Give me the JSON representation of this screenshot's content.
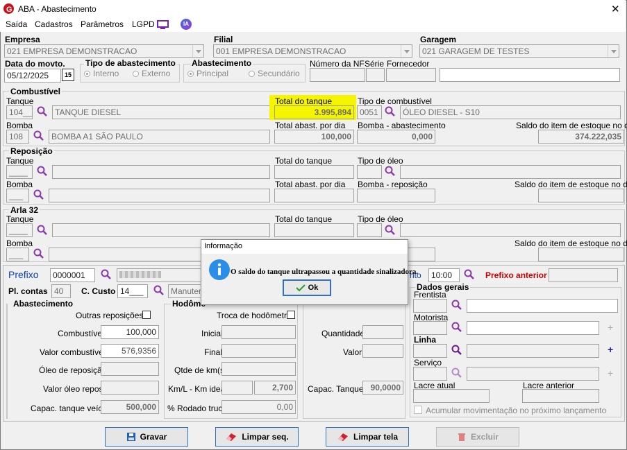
{
  "window": {
    "title": "ABA - Abastecimento",
    "close": "✕"
  },
  "menu": {
    "items": [
      "Saída",
      "Cadastros",
      "Parâmetros",
      "LGPD"
    ],
    "ia": "IA"
  },
  "header": {
    "empresa_label": "Empresa",
    "empresa": "021 EMPRESA DEMONSTRACAO",
    "filial_label": "Filial",
    "filial": "001 EMPRESA DEMONSTRACAO",
    "garagem_label": "Garagem",
    "garagem": "021 GARAGEM DE TESTES",
    "data_label": "Data do movto.",
    "data": "05/12/2025",
    "cal": "15",
    "tipo_label": "Tipo de abastecimento",
    "tipo_interno": "Interno",
    "tipo_externo": "Externo",
    "abast_label": "Abastecimento",
    "abast_principal": "Principal",
    "abast_secundario": "Secundário",
    "nf_label": "Número da NF",
    "serie_label": "Série",
    "fornecedor_label": "Fornecedor"
  },
  "combustivel": {
    "title": "Combustível",
    "tanque_label": "Tanque",
    "tanque_code": "104__",
    "tanque_name": "TANQUE DIESEL",
    "total_tanque_label": "Total do tanque",
    "total_tanque": "3.995,894",
    "tipo_label": "Tipo de combustível",
    "tipo_code": "0051",
    "tipo_name": "ÓLEO DIESEL - S10",
    "bomba_label": "Bomba",
    "bomba_code": "108",
    "bomba_name": "BOMBA A1 SÃO PAULO",
    "total_dia_label": "Total abast. por dia",
    "total_dia": "100,000",
    "bomba_abast_label": "Bomba - abastecimento",
    "bomba_abast": "0,000",
    "saldo_label": "Saldo do item de estoque no dia",
    "saldo": "374.222,035"
  },
  "reposicao": {
    "title": "Reposição",
    "tanque_label": "Tanque",
    "tanque_code": "____",
    "total_tanque_label": "Total do tanque",
    "tipo_label": "Tipo de óleo",
    "bomba_label": "Bomba",
    "bomba_code": "___",
    "total_dia_label": "Total abast. por dia",
    "bomba_rep_label": "Bomba - reposição",
    "saldo_label": "Saldo do item de estoque no dia"
  },
  "arla": {
    "title": "Arla 32",
    "tanque_label": "Tanque",
    "tanque_code": "____",
    "total_tanque_label": "Total do tanque",
    "tipo_label": "Tipo de óleo",
    "bomba_label": "Bomba",
    "bomba_code": "___",
    "saldo_label": "Saldo do item de estoque no dia"
  },
  "lower": {
    "prefixo_label": "Prefixo",
    "prefixo": "0000001",
    "hora_label": "nto",
    "hora": "10:00",
    "prefixo_ant_label": "Prefixo anterior",
    "pl_label": "Pl. contas",
    "pl": "40",
    "custo_label": "C. Custo",
    "custo": "14___",
    "custo_name": "Manuten"
  },
  "abastecimento": {
    "title": "Abastecimento",
    "outras_label": "Outras reposições",
    "combustivel_label": "Combustível",
    "combustivel": "100,000",
    "valor_comb_label": "Valor combustível",
    "valor_comb": "576,9356",
    "oleo_label": "Óleo de reposição",
    "valor_oleo_label": "Valor óleo repos.",
    "capac_label": "Capac. tanque veíc.",
    "capac": "500,000"
  },
  "hodometro": {
    "title": "Hodôme",
    "troca_label": "Troca de hodômetro",
    "inicial_label": "Inicial",
    "final_label": "Final",
    "qtde_label": "Qtde de km(s)",
    "kml_label": "Km/L - Km ideal",
    "kml_ideal": "2,700",
    "rodado_label": "% Rodado truck",
    "rodado": "0,00"
  },
  "arla_box": {
    "quantidade_label": "Quantidade",
    "valor_label": "Valor",
    "capac_label": "Capac. Tanque",
    "capac": "90,0000"
  },
  "dados": {
    "title": "Dados gerais",
    "frentista_label": "Frentista",
    "motorista_label": "Motorista",
    "linha_label": "Linha",
    "servico_label": "Serviço",
    "lacre_atual_label": "Lacre atual",
    "lacre_ant_label": "Lacre anterior",
    "acumular_label": "Acumular movimentação no próximo lançamento"
  },
  "buttons": {
    "gravar": "Gravar",
    "limpar_seq": "Limpar seq.",
    "limpar_tela": "Limpar tela",
    "excluir": "Excluir"
  },
  "dialog": {
    "title": "Informação",
    "message": "O saldo do tanque ultrapassou a quantidade sinalizadora.",
    "ok": "Ok"
  },
  "colors": {
    "highlight": "#f5f500",
    "accent": "#0a40c0",
    "red": "#cc0000",
    "magnifier": "#8a3aa8"
  }
}
